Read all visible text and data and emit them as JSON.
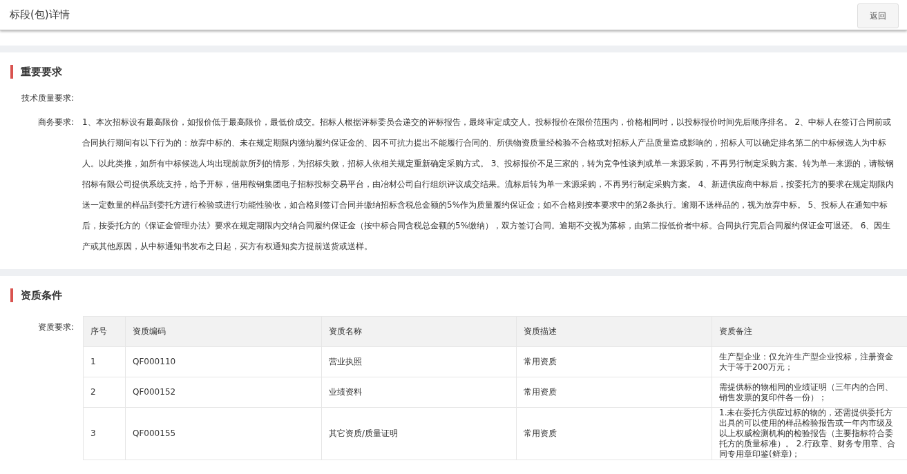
{
  "header": {
    "title": "标段(包)详情",
    "back_button": "返回"
  },
  "sections": [
    {
      "title": "重要要求",
      "kind": "fields",
      "fields": [
        {
          "label": "技术质量要求:"
        },
        {
          "label": "商务要求:",
          "value": "1、本次招标设有最高限价，如报价低于最高限价，最低价成交。招标人根据评标委员会递交的评标报告，最终审定成交人。投标报价在限价范围内，价格相同时，以投标报价时间先后顺序排名。 2、中标人在签订合同前或合同执行期间有以下行为的：放弃中标的、未在规定期限内缴纳履约保证金的、因不可抗力提出不能履行合同的、所供物资质量经检验不合格或对招标人产品质量造成影响的，招标人可以确定排名第二的中标候选人为中标人。以此类推，如所有中标候选人均出现前款所列的情形，为招标失败，招标人依相关规定重新确定采购方式。 3、投标报价不足三家的，转为竞争性谈判或单一来源采购，不再另行制定采购方案。转为单一来源的，请鞍钢招标有限公司提供系统支持，给予开标，借用鞍钢集团电子招标投标交易平台，由冶材公司自行组织评议成交结果。流标后转为单一来源采购，不再另行制定采购方案。 4、新进供应商中标后，按委托方的要求在规定期限内送一定数量的样品到委托方进行检验或进行功能性验收，如合格则签订合同并缴纳招标含税总金额的5%作为质量履约保证金；如不合格则按本要求中的第2条执行。逾期不送样品的，视为放弃中标。 5、投标人在通知中标后，按委托方的《保证金管理办法》要求在规定期限内交纳合同履约保证金（按中标合同含税总金额的5%缴纳），双方签订合同。逾期不交视为落标，由第二报低价者中标。合同执行完后合同履约保证金可退还。 6、因生产或其他原因，从中标通知书发布之日起，买方有权通知卖方提前送货或送样。"
        }
      ]
    },
    {
      "title": "资质条件",
      "kind": "table",
      "label": "资质要求:",
      "columns": [
        "序号",
        "资质编码",
        "资质名称",
        "资质描述",
        "资质备注"
      ],
      "rows": [
        [
          "1",
          "QF000110",
          "营业执照",
          "常用资质",
          "生产型企业：仅允许生产型企业投标，注册资金大于等于200万元；"
        ],
        [
          "2",
          "QF000152",
          "业绩资料",
          "常用资质",
          "需提供标的物相同的业绩证明（三年内的合同、销售发票的复印件各一份）；"
        ],
        [
          "3",
          "QF000155",
          "其它资质/质量证明",
          "常用资质",
          "1.未在委托方供应过标的物的，还需提供委托方出具的可以使用的样品检验报告或一年内市级及以上权威检测机构的检验报告（主要指标符合委托方的质量标准）。 2.行政章、财务专用章、合同专用章印鉴(鲜章)；"
        ]
      ]
    }
  ]
}
